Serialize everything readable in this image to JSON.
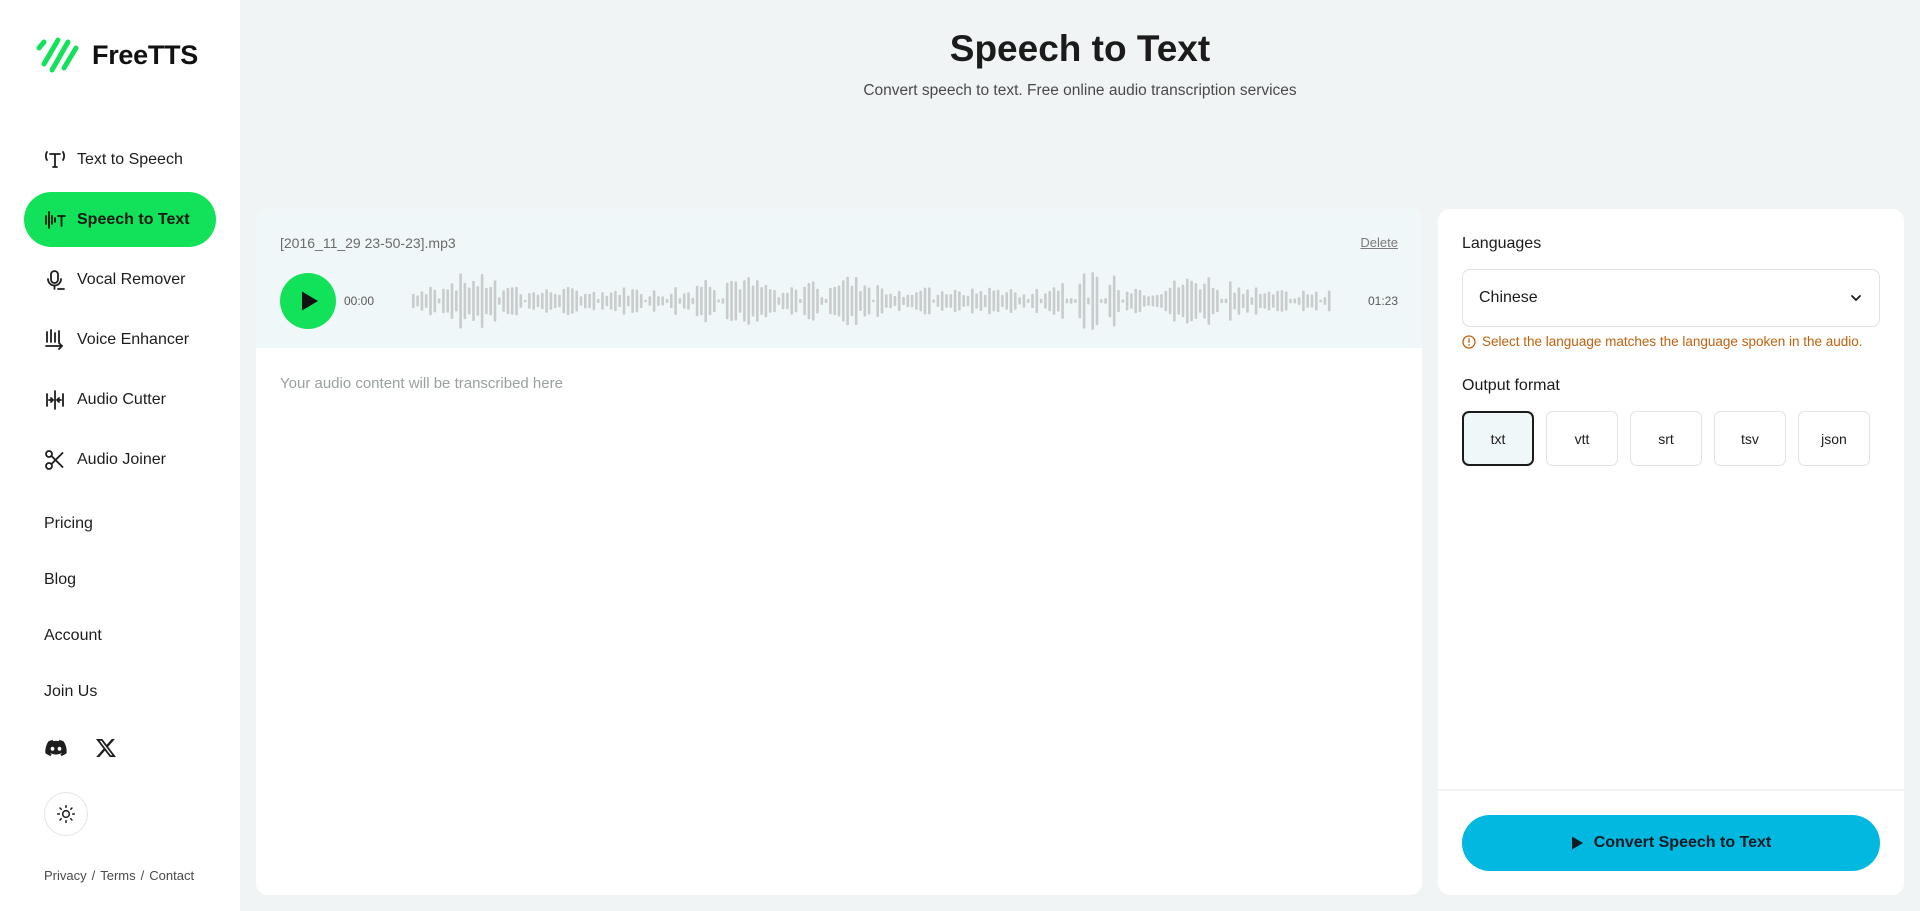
{
  "brand": {
    "name": "FreeTTS",
    "accent": "#12e25a"
  },
  "sidebar": {
    "items": [
      {
        "label": "Text to Speech",
        "icon": "text-icon",
        "active": false
      },
      {
        "label": "Speech to Text",
        "icon": "waveform-text-icon",
        "active": true
      },
      {
        "label": "Vocal Remover",
        "icon": "microphone-icon",
        "active": false
      },
      {
        "label": "Voice Enhancer",
        "icon": "enhance-icon",
        "active": false
      },
      {
        "label": "Audio Cutter",
        "icon": "split-icon",
        "active": false
      },
      {
        "label": "Audio Joiner",
        "icon": "scissors-icon",
        "active": false
      }
    ],
    "links": [
      "Pricing",
      "Blog",
      "Account",
      "Join Us"
    ],
    "socials": [
      "discord-icon",
      "x-icon"
    ],
    "theme_icon": "sun-icon",
    "footer": {
      "privacy": "Privacy",
      "terms": "Terms",
      "contact": "Contact",
      "separator": "/"
    }
  },
  "header": {
    "title": "Speech to Text",
    "subtitle": "Convert speech to text. Free online audio transcription services"
  },
  "player": {
    "file_name": "[2016_11_29 23-50-23].mp3",
    "delete_label": "Delete",
    "current_time": "00:00",
    "duration": "01:23"
  },
  "transcript": {
    "placeholder": "Your audio content will be transcribed here"
  },
  "settings": {
    "languages_label": "Languages",
    "language_value": "Chinese",
    "language_hint": "Select the language matches the language spoken in the audio.",
    "hint_color": "#c0620f",
    "output_format_label": "Output format",
    "formats": [
      "txt",
      "vtt",
      "srt",
      "tsv",
      "json"
    ],
    "selected_format": "txt"
  },
  "convert": {
    "label": "Convert Speech to Text",
    "color": "#00b8e0"
  }
}
